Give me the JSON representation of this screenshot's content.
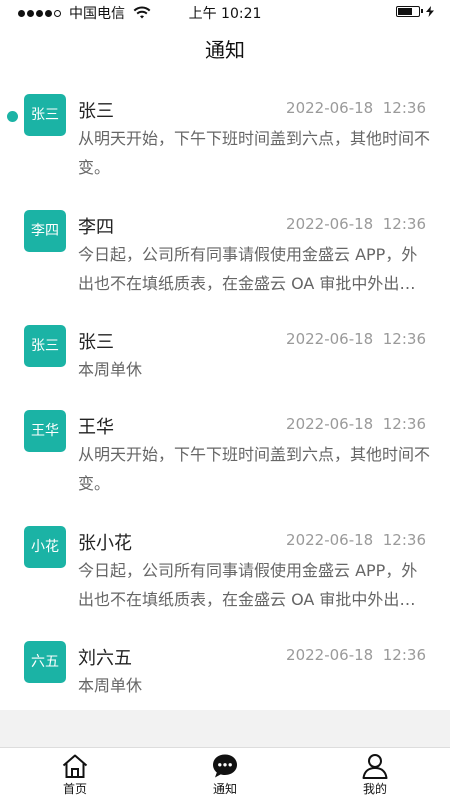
{
  "status_bar": {
    "carrier": "中国电信",
    "time": "上午 10:21"
  },
  "nav": {
    "title": "通知"
  },
  "notifications": [
    {
      "avatar": "张三",
      "name": "张三",
      "date": "2022-06-18",
      "time": "12:36",
      "message": "从明天开始，下午下班时间盖到六点，其他时间不变。",
      "unread": true
    },
    {
      "avatar": "李四",
      "name": "李四",
      "date": "2022-06-18",
      "time": "12:36",
      "message": "今日起，公司所有同事请假使用金盛云 APP，外出也不在填纸质表，在金盛云 OA 审批中外出申请",
      "unread": false
    },
    {
      "avatar": "张三",
      "name": "张三",
      "date": "2022-06-18",
      "time": "12:36",
      "message": "本周单休",
      "unread": false
    },
    {
      "avatar": "王华",
      "name": "王华",
      "date": "2022-06-18",
      "time": "12:36",
      "message": "从明天开始，下午下班时间盖到六点，其他时间不变。",
      "unread": false
    },
    {
      "avatar": "小花",
      "name": "张小花",
      "date": "2022-06-18",
      "time": "12:36",
      "message": "今日起，公司所有同事请假使用金盛云 APP，外出也不在填纸质表，在金盛云 OA 审批中外出申请",
      "unread": false
    },
    {
      "avatar": "六五",
      "name": "刘六五",
      "date": "2022-06-18",
      "time": "12:36",
      "message": "本周单休",
      "unread": false
    }
  ],
  "tabs": [
    {
      "label": "首页",
      "icon": "home-icon"
    },
    {
      "label": "通知",
      "icon": "chat-bubble-icon",
      "active": true
    },
    {
      "label": "我的",
      "icon": "user-icon"
    }
  ]
}
